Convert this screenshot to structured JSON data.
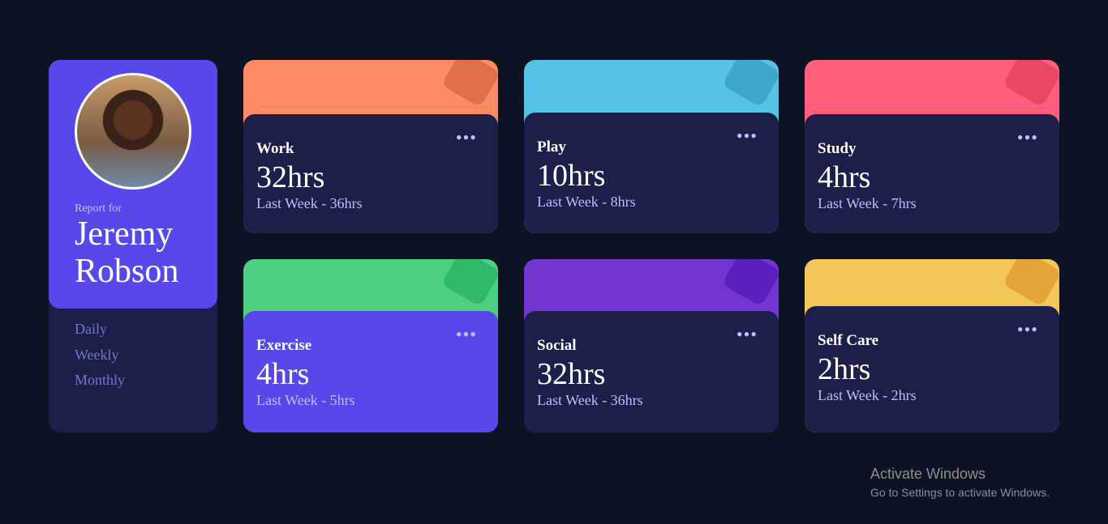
{
  "profile": {
    "report_for": "Report for",
    "name": "Jeremy Robson",
    "periods": [
      "Daily",
      "Weekly",
      "Monthly"
    ]
  },
  "cards": [
    {
      "title": "Work",
      "current": "32hrs",
      "previous": "Last Week - 36hrs",
      "color": "#ff8b64",
      "icon": "briefcase-icon"
    },
    {
      "title": "Play",
      "current": "10hrs",
      "previous": "Last Week - 8hrs",
      "color": "#55c2e6",
      "icon": "gamepad-icon"
    },
    {
      "title": "Study",
      "current": "4hrs",
      "previous": "Last Week - 7hrs",
      "color": "#ff5e7d",
      "icon": "books-icon"
    },
    {
      "title": "Exercise",
      "current": "4hrs",
      "previous": "Last Week - 5hrs",
      "color": "#4bcf82",
      "icon": "running-icon"
    },
    {
      "title": "Social",
      "current": "32hrs",
      "previous": "Last Week - 36hrs",
      "color": "#7335d2",
      "icon": "chat-bubbles-icon"
    },
    {
      "title": "Self Care",
      "current": "2hrs",
      "previous": "Last Week - 2hrs",
      "color": "#f1c75b",
      "icon": "heart-bandage-icon"
    }
  ],
  "menu_label": "•••",
  "watermark": {
    "title": "Activate Windows",
    "subtitle": "Go to Settings to activate Windows."
  }
}
